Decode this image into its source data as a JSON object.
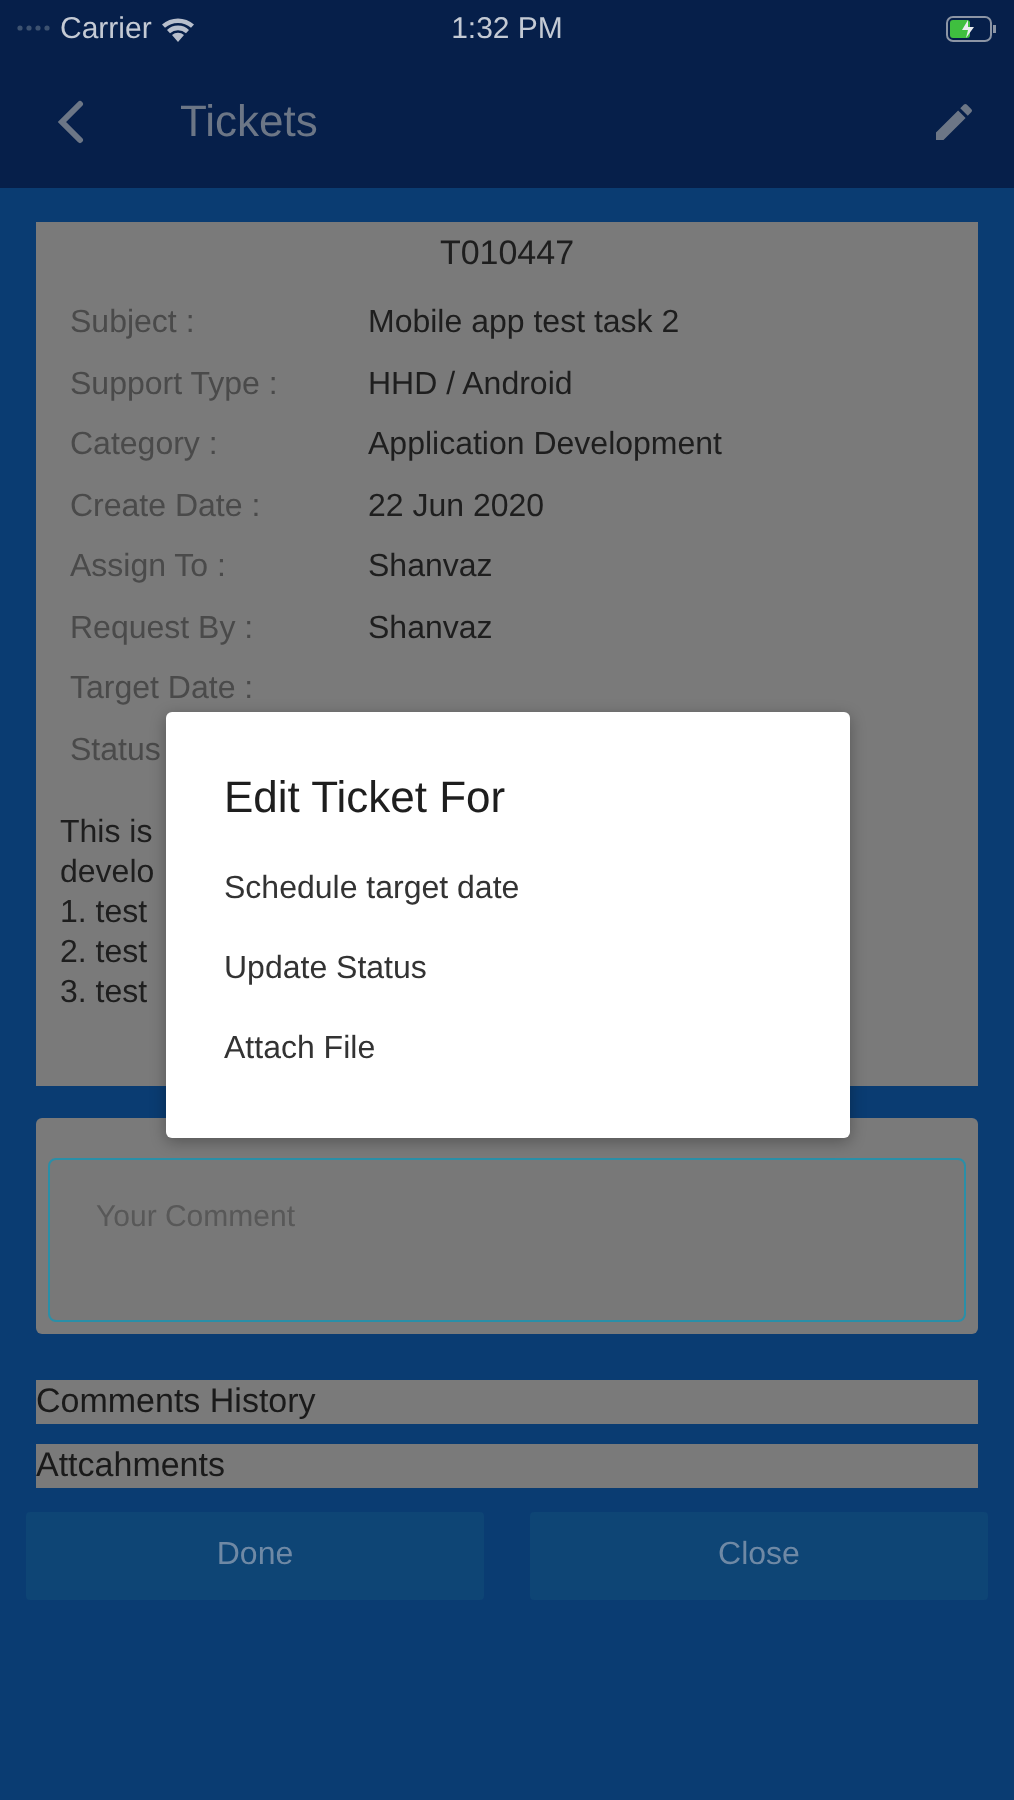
{
  "status_bar": {
    "carrier": "Carrier",
    "time": "1:32 PM"
  },
  "nav": {
    "title": "Tickets"
  },
  "ticket": {
    "id": "T010447",
    "fields": [
      {
        "label": "Subject :",
        "value": "Mobile app test task 2"
      },
      {
        "label": "Support Type :",
        "value": "HHD / Android"
      },
      {
        "label": "Category :",
        "value": "Application Development"
      },
      {
        "label": "Create Date :",
        "value": "22 Jun 2020"
      },
      {
        "label": "Assign To :",
        "value": "Shanvaz"
      },
      {
        "label": "Request By :",
        "value": "Shanvaz"
      },
      {
        "label": "Target Date :"
      },
      {
        "label": "Status"
      }
    ],
    "description_lines": [
      "This is",
      "develo",
      "1. test",
      "2. test",
      "3. test"
    ]
  },
  "comments": {
    "placeholder": "Your Comment"
  },
  "sections": [
    "Comments History",
    "Attcahments"
  ],
  "buttons": [
    "Done",
    "Close"
  ],
  "dialog": {
    "title": "Edit Ticket For",
    "options": [
      "Schedule target date",
      "Update Status",
      "Attach File"
    ]
  }
}
